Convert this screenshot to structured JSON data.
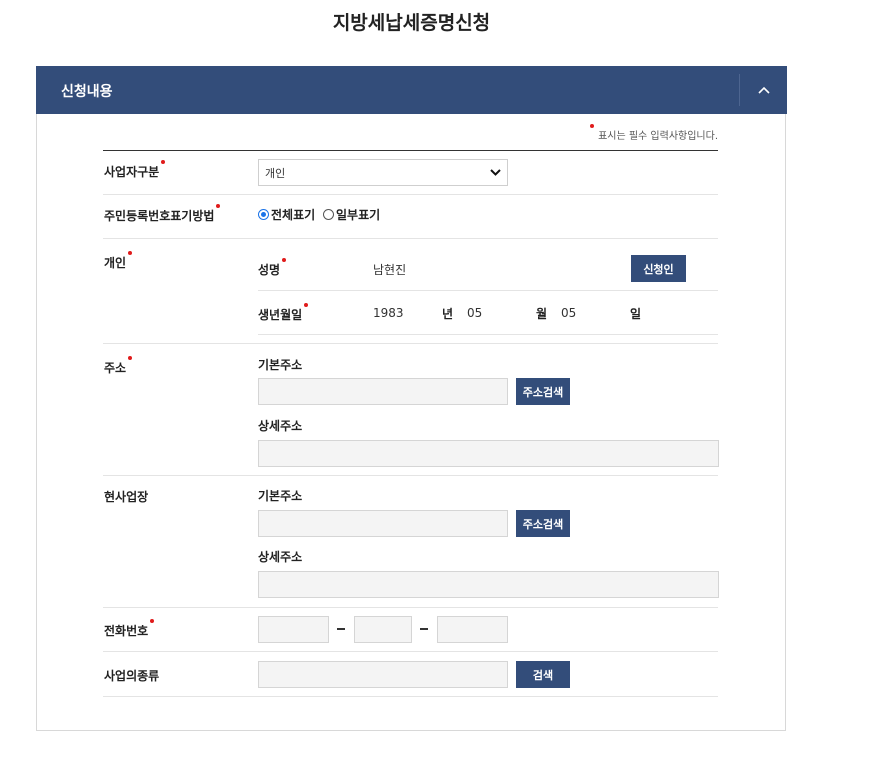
{
  "page": {
    "title": "지방세납세증명신청"
  },
  "panel": {
    "title": "신청내용",
    "required_note": "표시는 필수 입력사항입니다."
  },
  "colors": {
    "header_bg": "#334d7a",
    "button_bg": "#334d7a",
    "required_dot": "#e01b1b",
    "field_bg": "#f4f4f4"
  },
  "business_type": {
    "label": "사업자구분",
    "selected": "개인"
  },
  "rrn_display": {
    "label": "주민등록번호표기방법",
    "options": [
      {
        "label": "전체표기",
        "selected": true
      },
      {
        "label": "일부표기",
        "selected": false
      }
    ]
  },
  "individual": {
    "label": "개인",
    "name_label": "성명",
    "name_value": "남현진",
    "applicant_button": "신청인",
    "birth_label": "생년월일",
    "birth_year": "1983",
    "year_unit": "년",
    "birth_month": "05",
    "month_unit": "월",
    "birth_day": "05",
    "day_unit": "일"
  },
  "address": {
    "label": "주소",
    "basic_label": "기본주소",
    "basic_value": "",
    "search_button": "주소검색",
    "detail_label": "상세주소",
    "detail_value": ""
  },
  "workplace": {
    "label": "현사업장",
    "basic_label": "기본주소",
    "basic_value": "",
    "search_button": "주소검색",
    "detail_label": "상세주소",
    "detail_value": ""
  },
  "phone": {
    "label": "전화번호",
    "part1": "",
    "part2": "",
    "part3": ""
  },
  "business_kind": {
    "label": "사업의종류",
    "value": "",
    "search_button": "검색"
  }
}
